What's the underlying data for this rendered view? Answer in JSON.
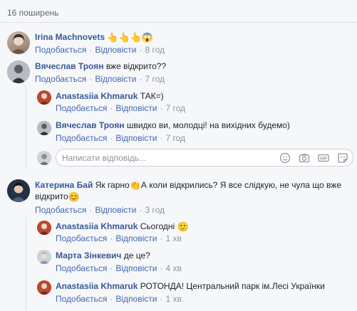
{
  "shares": "16 поширень",
  "actions": {
    "like": "Подобається",
    "reply": "Відповісти"
  },
  "reply_placeholder": "Написати відповідь...",
  "comments": [
    {
      "author": "Irina Machnovets",
      "text": "👆👆👆😱",
      "time": "8 год"
    },
    {
      "author": "Вячеслав Троян",
      "text": "вже відкрито??",
      "time": "7 год",
      "replies": [
        {
          "author": "Anastasiia Khmaruk",
          "text": "ТАК=)",
          "time": "7 год"
        },
        {
          "author": "Вячеслав Троян",
          "text": "швидко ви, молодці! на вихідних будемо)",
          "time": "7 год"
        }
      ]
    },
    {
      "author": "Катерина Бай",
      "text_line1_a": "Як гарно",
      "text_line1_emoji": "👏",
      "text_line1_b": "А коли відкрились? Я все слідкую, не чула що вже",
      "text_line2": "відкрито",
      "text_line2_emoji": "😊",
      "time": "3 год",
      "replies": [
        {
          "author": "Anastasiia Khmaruk",
          "text": "Сьогодні",
          "emoji": "🙂",
          "time": "1 хв"
        },
        {
          "author": "Марта Зінкевич",
          "text": "де це?",
          "time": "4 хв"
        },
        {
          "author": "Anastasiia Khmaruk",
          "text": "РОТОНДА! Центральний парк ім.Лесі Українки",
          "time": "1 хв."
        }
      ]
    }
  ],
  "icons": [
    "smiley-icon",
    "camera-icon",
    "gif-icon",
    "sticker-icon"
  ]
}
